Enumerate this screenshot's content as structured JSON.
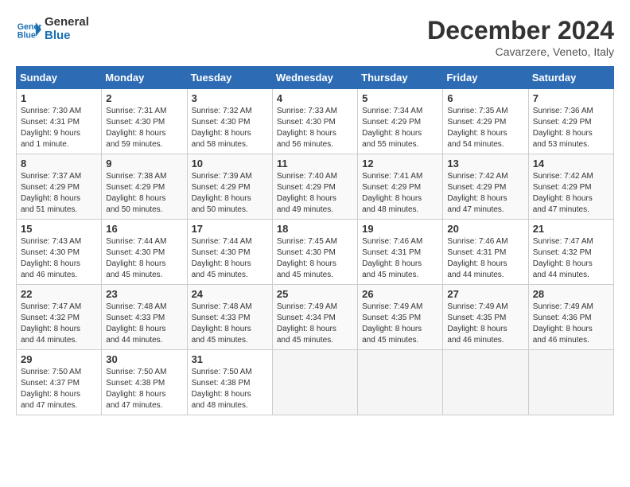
{
  "header": {
    "logo_line1": "General",
    "logo_line2": "Blue",
    "month_title": "December 2024",
    "subtitle": "Cavarzere, Veneto, Italy"
  },
  "days_of_week": [
    "Sunday",
    "Monday",
    "Tuesday",
    "Wednesday",
    "Thursday",
    "Friday",
    "Saturday"
  ],
  "weeks": [
    [
      {
        "day": 1,
        "rise": "7:30 AM",
        "set": "4:31 PM",
        "hours": "9 hours",
        "mins": "1 minute."
      },
      {
        "day": 2,
        "rise": "7:31 AM",
        "set": "4:30 PM",
        "hours": "8 hours",
        "mins": "59 minutes."
      },
      {
        "day": 3,
        "rise": "7:32 AM",
        "set": "4:30 PM",
        "hours": "8 hours",
        "mins": "58 minutes."
      },
      {
        "day": 4,
        "rise": "7:33 AM",
        "set": "4:30 PM",
        "hours": "8 hours",
        "mins": "56 minutes."
      },
      {
        "day": 5,
        "rise": "7:34 AM",
        "set": "4:29 PM",
        "hours": "8 hours",
        "mins": "55 minutes."
      },
      {
        "day": 6,
        "rise": "7:35 AM",
        "set": "4:29 PM",
        "hours": "8 hours",
        "mins": "54 minutes."
      },
      {
        "day": 7,
        "rise": "7:36 AM",
        "set": "4:29 PM",
        "hours": "8 hours",
        "mins": "53 minutes."
      }
    ],
    [
      {
        "day": 8,
        "rise": "7:37 AM",
        "set": "4:29 PM",
        "hours": "8 hours",
        "mins": "51 minutes."
      },
      {
        "day": 9,
        "rise": "7:38 AM",
        "set": "4:29 PM",
        "hours": "8 hours",
        "mins": "50 minutes."
      },
      {
        "day": 10,
        "rise": "7:39 AM",
        "set": "4:29 PM",
        "hours": "8 hours",
        "mins": "50 minutes."
      },
      {
        "day": 11,
        "rise": "7:40 AM",
        "set": "4:29 PM",
        "hours": "8 hours",
        "mins": "49 minutes."
      },
      {
        "day": 12,
        "rise": "7:41 AM",
        "set": "4:29 PM",
        "hours": "8 hours",
        "mins": "48 minutes."
      },
      {
        "day": 13,
        "rise": "7:42 AM",
        "set": "4:29 PM",
        "hours": "8 hours",
        "mins": "47 minutes."
      },
      {
        "day": 14,
        "rise": "7:42 AM",
        "set": "4:29 PM",
        "hours": "8 hours",
        "mins": "47 minutes."
      }
    ],
    [
      {
        "day": 15,
        "rise": "7:43 AM",
        "set": "4:30 PM",
        "hours": "8 hours",
        "mins": "46 minutes."
      },
      {
        "day": 16,
        "rise": "7:44 AM",
        "set": "4:30 PM",
        "hours": "8 hours",
        "mins": "45 minutes."
      },
      {
        "day": 17,
        "rise": "7:44 AM",
        "set": "4:30 PM",
        "hours": "8 hours",
        "mins": "45 minutes."
      },
      {
        "day": 18,
        "rise": "7:45 AM",
        "set": "4:30 PM",
        "hours": "8 hours",
        "mins": "45 minutes."
      },
      {
        "day": 19,
        "rise": "7:46 AM",
        "set": "4:31 PM",
        "hours": "8 hours",
        "mins": "45 minutes."
      },
      {
        "day": 20,
        "rise": "7:46 AM",
        "set": "4:31 PM",
        "hours": "8 hours",
        "mins": "44 minutes."
      },
      {
        "day": 21,
        "rise": "7:47 AM",
        "set": "4:32 PM",
        "hours": "8 hours",
        "mins": "44 minutes."
      }
    ],
    [
      {
        "day": 22,
        "rise": "7:47 AM",
        "set": "4:32 PM",
        "hours": "8 hours",
        "mins": "44 minutes."
      },
      {
        "day": 23,
        "rise": "7:48 AM",
        "set": "4:33 PM",
        "hours": "8 hours",
        "mins": "44 minutes."
      },
      {
        "day": 24,
        "rise": "7:48 AM",
        "set": "4:33 PM",
        "hours": "8 hours",
        "mins": "45 minutes."
      },
      {
        "day": 25,
        "rise": "7:49 AM",
        "set": "4:34 PM",
        "hours": "8 hours",
        "mins": "45 minutes."
      },
      {
        "day": 26,
        "rise": "7:49 AM",
        "set": "4:35 PM",
        "hours": "8 hours",
        "mins": "45 minutes."
      },
      {
        "day": 27,
        "rise": "7:49 AM",
        "set": "4:35 PM",
        "hours": "8 hours",
        "mins": "46 minutes."
      },
      {
        "day": 28,
        "rise": "7:49 AM",
        "set": "4:36 PM",
        "hours": "8 hours",
        "mins": "46 minutes."
      }
    ],
    [
      {
        "day": 29,
        "rise": "7:50 AM",
        "set": "4:37 PM",
        "hours": "8 hours",
        "mins": "47 minutes."
      },
      {
        "day": 30,
        "rise": "7:50 AM",
        "set": "4:38 PM",
        "hours": "8 hours",
        "mins": "47 minutes."
      },
      {
        "day": 31,
        "rise": "7:50 AM",
        "set": "4:38 PM",
        "hours": "8 hours",
        "mins": "48 minutes."
      },
      null,
      null,
      null,
      null
    ]
  ]
}
